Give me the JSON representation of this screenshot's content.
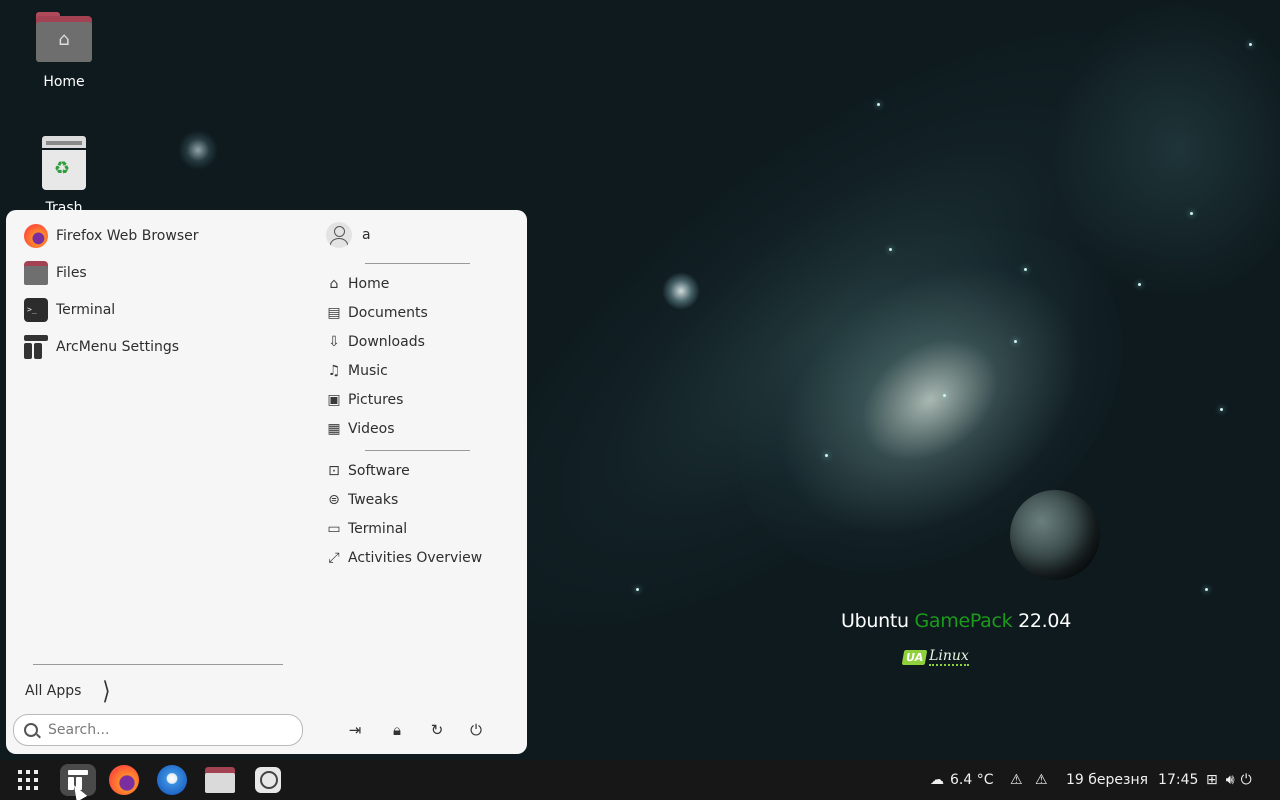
{
  "desktop": {
    "icons": [
      {
        "label": "Home"
      },
      {
        "label": "Trash"
      }
    ],
    "brand": {
      "part1": "Ubuntu ",
      "part2": "GamePack",
      "part3": " 22.04",
      "logo_badge": "UA",
      "logo_text": "Linux"
    },
    "colors": {
      "brand_green": "#1c9a1c",
      "background": "#0e1a1e"
    }
  },
  "menu": {
    "favorites": [
      {
        "label": "Firefox Web Browser",
        "icon": "firefox-icon"
      },
      {
        "label": "Files",
        "icon": "files-icon"
      },
      {
        "label": "Terminal",
        "icon": "terminal-icon"
      },
      {
        "label": "ArcMenu Settings",
        "icon": "arcmenu-settings-icon"
      }
    ],
    "user": {
      "name": "a"
    },
    "places": [
      {
        "label": "Home",
        "icon": "home-icon"
      },
      {
        "label": "Documents",
        "icon": "document-icon"
      },
      {
        "label": "Downloads",
        "icon": "download-icon"
      },
      {
        "label": "Music",
        "icon": "music-icon"
      },
      {
        "label": "Pictures",
        "icon": "picture-icon"
      },
      {
        "label": "Videos",
        "icon": "video-icon"
      }
    ],
    "shortcuts": [
      {
        "label": "Software",
        "icon": "software-icon"
      },
      {
        "label": "Tweaks",
        "icon": "tweaks-icon"
      },
      {
        "label": "Terminal",
        "icon": "terminal-icon"
      },
      {
        "label": "Activities Overview",
        "icon": "expand-icon"
      }
    ],
    "all_apps_label": "All Apps",
    "search_placeholder": "Search...",
    "power_buttons": [
      "logout-icon",
      "lock-icon",
      "restart-icon",
      "power-icon"
    ]
  },
  "taskbar": {
    "apps": [
      "app-grid-icon",
      "arcmenu-icon",
      "firefox-icon",
      "thunderbird-icon",
      "files-icon",
      "chat-icon"
    ],
    "weather": "6.4 °C",
    "date": "19 березня",
    "time": "17:45",
    "tray_icons": [
      "warning-icon",
      "warning-icon",
      "network-icon",
      "volume-icon",
      "power-icon"
    ]
  }
}
